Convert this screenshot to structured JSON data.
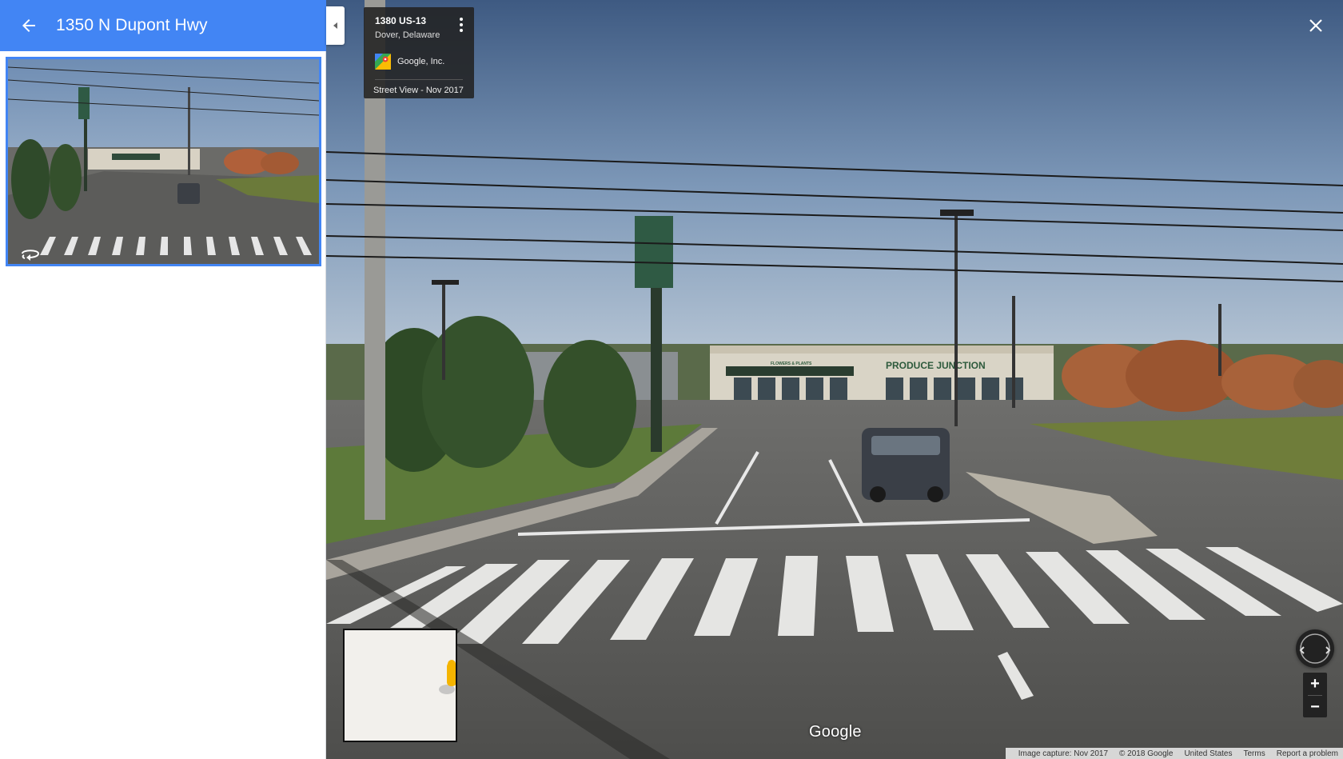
{
  "header": {
    "title": "1350 N Dupont Hwy",
    "back_icon": "arrow-back-icon"
  },
  "thumbnail": {
    "overlay_icon": "360-rotate-icon"
  },
  "info_card": {
    "title": "1380 US-13",
    "subtitle": "Dover, Delaware",
    "contributor": "Google, Inc.",
    "contributor_icon": "google-maps-icon",
    "date": "Street View - Nov 2017",
    "menu_icon": "more-vert-icon"
  },
  "scene": {
    "store_sign": "PRODUCE JUNCTION",
    "store_sub_sign": "FLOWERS & PLANTS"
  },
  "branding": {
    "logo": "Google"
  },
  "controls": {
    "zoom_in": "+",
    "zoom_out": "−",
    "compass_icon": "compass-icon",
    "close_icon": "close-icon",
    "collapse_icon": "collapse-arrow-icon"
  },
  "attribution": {
    "capture": "Image capture: Nov 2017",
    "copyright": "© 2018 Google",
    "country": "United States",
    "terms": "Terms",
    "report": "Report a problem"
  },
  "colors": {
    "header_blue": "#4285f4",
    "card_bg": "#222222"
  }
}
